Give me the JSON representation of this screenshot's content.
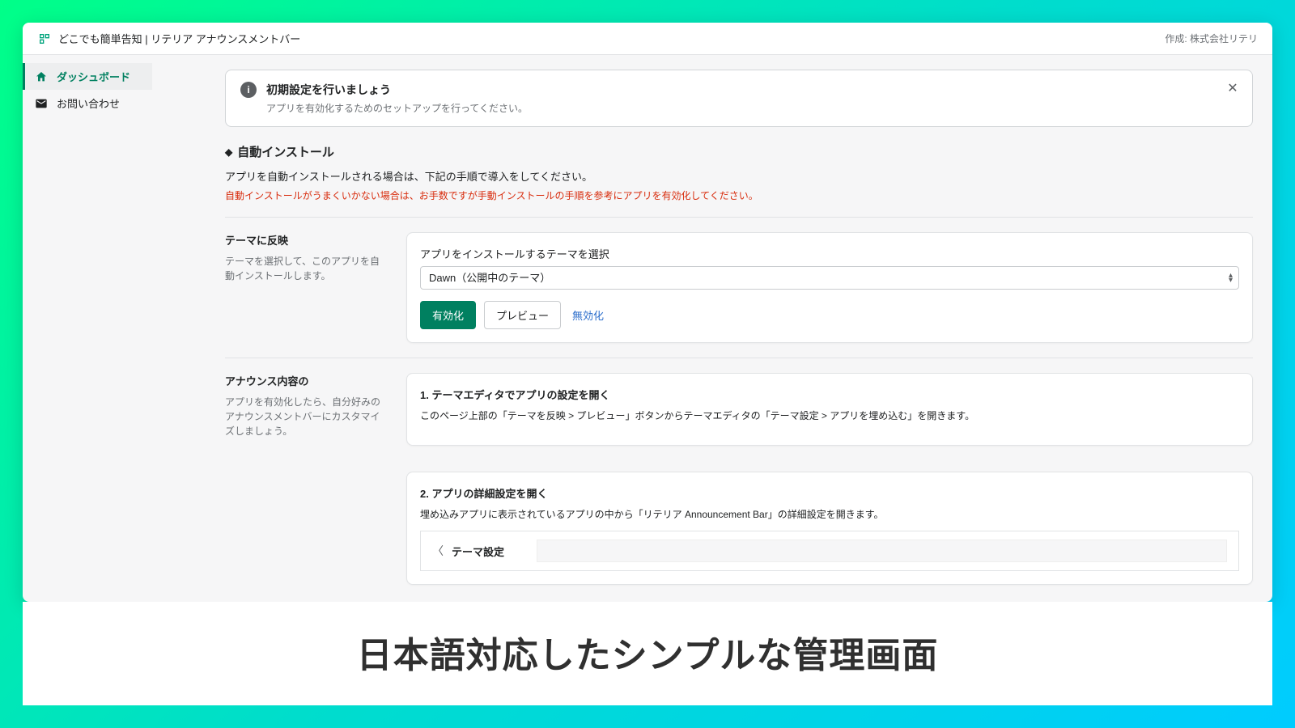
{
  "header": {
    "title": "どこでも簡単告知 | リテリア アナウンスメントバー",
    "attribution": "作成: 株式会社リテリ"
  },
  "sidebar": {
    "items": [
      {
        "label": "ダッシュボード",
        "icon": "home-icon"
      },
      {
        "label": "お問い合わせ",
        "icon": "mail-icon"
      }
    ]
  },
  "banner": {
    "title": "初期設定を行いましょう",
    "text": "アプリを有効化するためのセットアップを行ってください。"
  },
  "auto_install": {
    "heading": "自動インストール",
    "desc": "アプリを自動インストールされる場合は、下記の手順で導入をしてください。",
    "warn": "自動インストールがうまくいかない場合は、お手数ですが手動インストールの手順を参考にアプリを有効化してください。"
  },
  "theme_reflect": {
    "left_title": "テーマに反映",
    "left_desc": "テーマを選択して、このアプリを自動インストールします。",
    "field_label": "アプリをインストールするテーマを選択",
    "select_value": "Dawn（公開中のテーマ）",
    "enable_label": "有効化",
    "preview_label": "プレビュー",
    "disable_label": "無効化"
  },
  "announce": {
    "left_title": "アナウンス内容の",
    "left_desc": "アプリを有効化したら、自分好みのアナウンスメントバーにカスタマイズしましょう。",
    "step1_title": "1. テーマエディタでアプリの設定を開く",
    "step1_text": "このページ上部の「テーマを反映 > プレビュー」ボタンからテーマエディタの「テーマ設定 > アプリを埋め込む」を開きます。",
    "step2_title": "2. アプリの詳細設定を開く",
    "step2_text": "埋め込みアプリに表示されているアプリの中から「リテリア Announcement Bar」の詳細設定を開きます。",
    "screenshot_label": "テーマ設定"
  },
  "caption": "日本語対応したシンプルな管理画面"
}
